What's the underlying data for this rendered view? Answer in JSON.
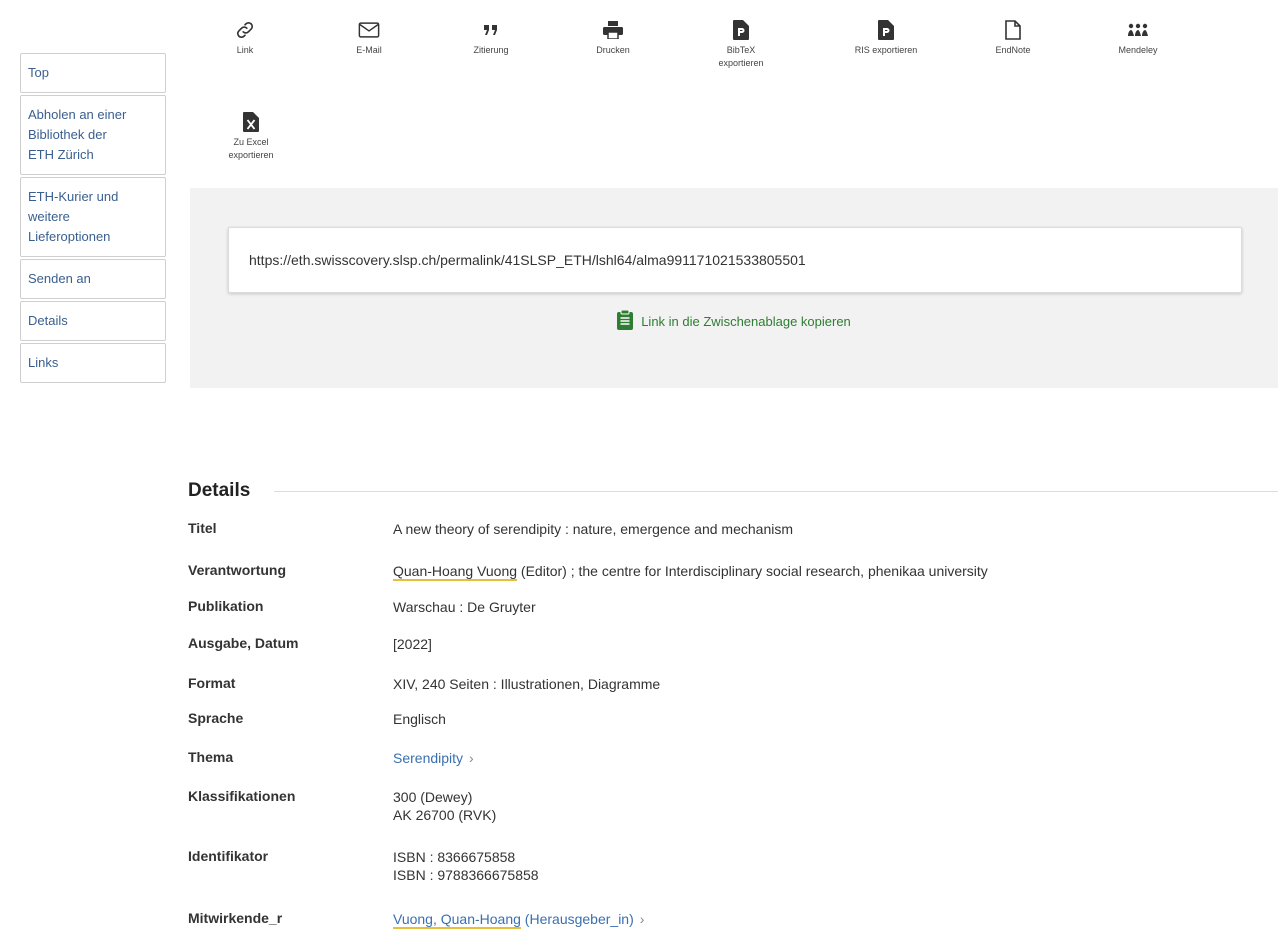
{
  "sidebar": {
    "items": [
      {
        "label": "Top"
      },
      {
        "label": "Abholen an einer Bibliothek der ETH Zürich",
        "lines": [
          "Abholen an einer",
          "Bibliothek der",
          "ETH Zürich"
        ]
      },
      {
        "label": "ETH-Kurier und weitere Lieferoptionen",
        "lines": [
          "ETH-Kurier und",
          "weitere",
          "Lieferoptionen"
        ]
      },
      {
        "label": "Senden an"
      },
      {
        "label": "Details"
      },
      {
        "label": "Links"
      }
    ]
  },
  "actions": {
    "link": {
      "label": "Link",
      "icon": "link-icon"
    },
    "email": {
      "label": "E-Mail",
      "icon": "envelope-icon"
    },
    "citation": {
      "label": "Zitierung",
      "icon": "quote-icon"
    },
    "print": {
      "label": "Drucken",
      "icon": "printer-icon"
    },
    "bibtex": {
      "label_line1": "BibTeX",
      "label_line2": "exportieren",
      "icon": "file-export-icon"
    },
    "ris": {
      "label": "RIS exportieren",
      "icon": "file-export-icon"
    },
    "endnote": {
      "label": "EndNote",
      "icon": "file-icon"
    },
    "mendeley": {
      "label": "Mendeley",
      "icon": "mendeley-icon"
    },
    "excel": {
      "label_line1": "Zu Excel",
      "label_line2": "exportieren",
      "icon": "excel-icon"
    }
  },
  "permalink": {
    "url": "https://eth.swisscovery.slsp.ch/permalink/41SLSP_ETH/lshl64/alma991171021533805501",
    "copy_label": "Link in die Zwischenablage kopieren"
  },
  "details": {
    "heading": "Details",
    "rows": [
      {
        "key": "Titel",
        "value": "A new theory of serendipity : nature, emergence and mechanism"
      },
      {
        "key": "Verantwortung",
        "link": "Quan-Hoang Vuong",
        "value": " (Editor) ; the centre for Interdisciplinary social research, phenikaa university"
      },
      {
        "key": "Publikation",
        "value": "Warschau : De Gruyter"
      },
      {
        "key": "Ausgabe, Datum",
        "value": "[2022]"
      },
      {
        "key": "Format",
        "value": "XIV, 240 Seiten : Illustrationen, Diagramme"
      },
      {
        "key": "Sprache",
        "value": "Englisch"
      },
      {
        "key": "Thema",
        "value": "Serendipity"
      },
      {
        "key": "Klassifikationen",
        "values": [
          "300 (Dewey)",
          "AK 26700 (RVK)"
        ]
      },
      {
        "key": "Identifikator",
        "values": [
          "ISBN : 8366675858",
          "ISBN : 9788366675858"
        ]
      },
      {
        "key": "Mitwirkende_r",
        "link": "Vuong, Quan-Hoang",
        "value": " (Herausgeber_in)"
      }
    ]
  },
  "colors": {
    "link": "#3a6fb0",
    "copy": "#2e7d32",
    "panel": "#f2f2f2"
  }
}
